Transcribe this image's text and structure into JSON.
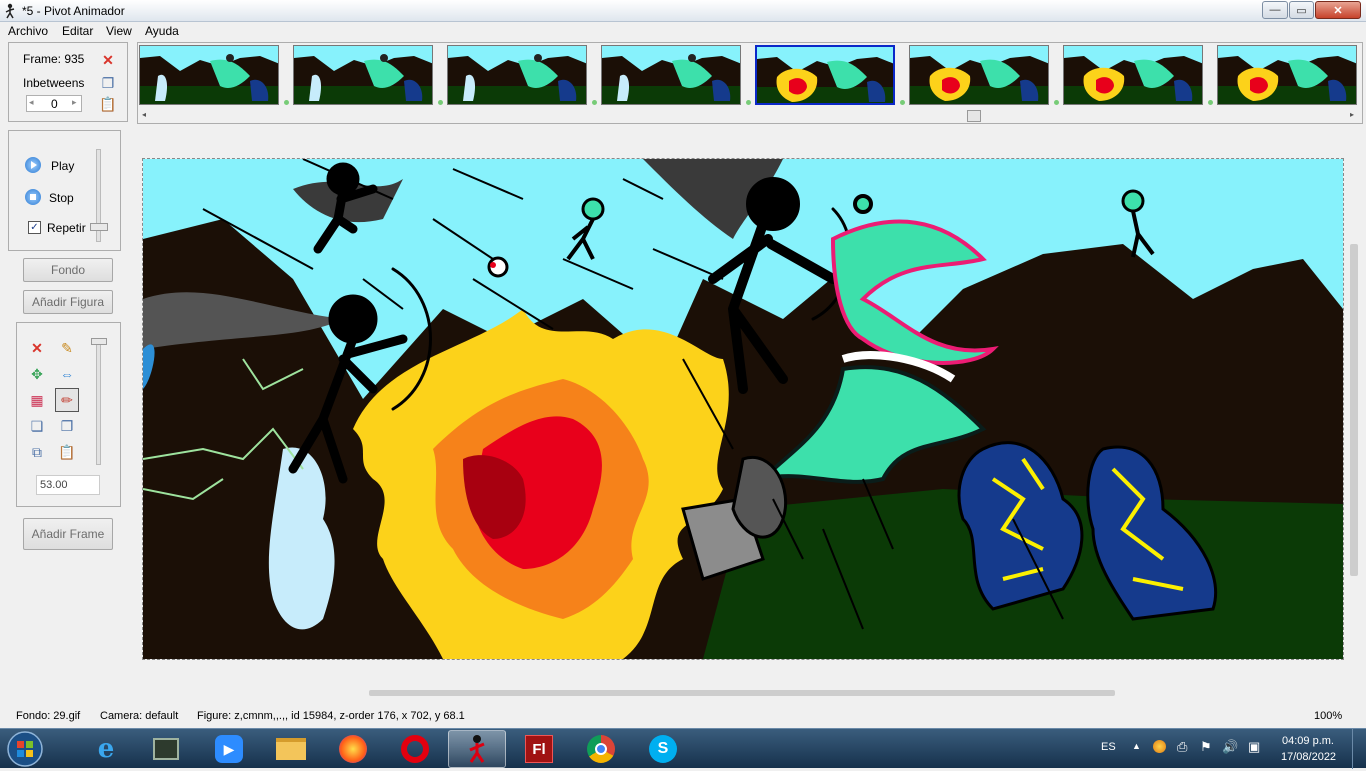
{
  "window": {
    "title": "*5 - Pivot Animador",
    "min_glyph": "—",
    "max_glyph": "▭",
    "close_glyph": "✕"
  },
  "menu": [
    "Archivo",
    "Editar",
    "View",
    "Ayuda"
  ],
  "frame_panel": {
    "frame_label": "Frame: 935",
    "inbetweens_label": "Inbetweens",
    "inbetweens_value": "0"
  },
  "playback": {
    "play": "Play",
    "stop": "Stop",
    "repeat": "Repetir",
    "repeat_checked": true
  },
  "buttons": {
    "background": "Fondo",
    "add_figure": "Añadir Figura",
    "add_frame": "Añadir Frame"
  },
  "tools": {
    "size_value": "53.00"
  },
  "timeline": {
    "selected_index": 4,
    "thumb_count": 8
  },
  "status": {
    "background": "Fondo: 29.gif",
    "camera": "Camera: default",
    "figure": "Figure: z,cmnm,,.,,  id 15984,  z-order 176,  x 702, y 68.1",
    "zoom": "100%"
  },
  "taskbar": {
    "apps": [
      "internet-explorer",
      "terminal",
      "zoom",
      "file-explorer",
      "firefox",
      "opera",
      "pivot-animator",
      "flash",
      "chrome",
      "skype"
    ],
    "language": "ES",
    "time": "04:09 p.m.",
    "date": "17/08/2022"
  },
  "colors": {
    "sky": "#87f2fc",
    "ground": "#0b3a06",
    "mountain": "#1b0f06",
    "fire_yellow": "#fcd21a",
    "fire_orange": "#f6821a",
    "fire_red": "#e8001b",
    "creature_green": "#3de0ab",
    "golem_blue": "#153a8c",
    "selection": "#0b28c8"
  }
}
